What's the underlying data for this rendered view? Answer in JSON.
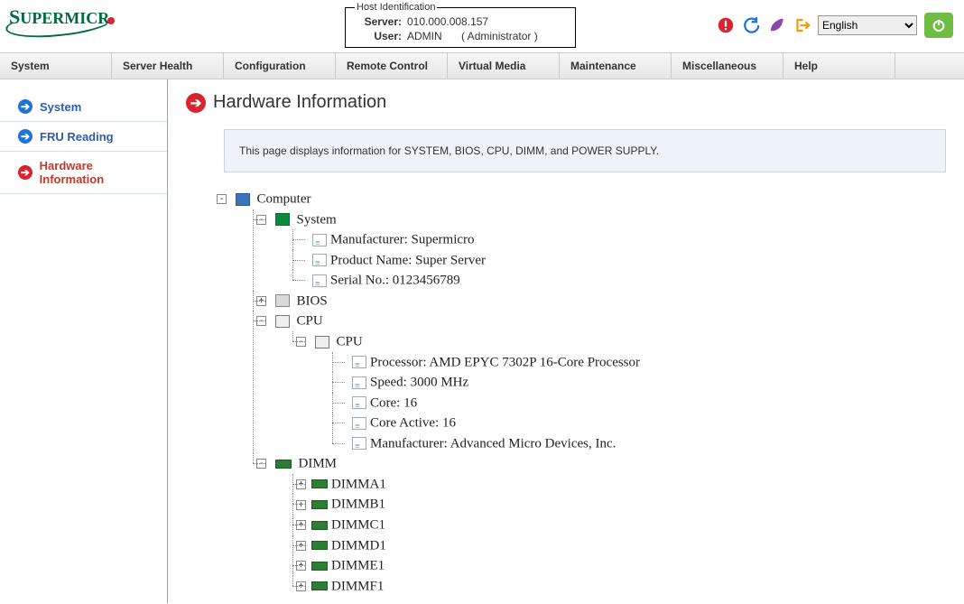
{
  "host_identification": {
    "legend": "Host Identification",
    "server_label": "Server:",
    "server_value": "010.000.008.157",
    "user_label": "User:",
    "user_value": "ADMIN",
    "role": "( Administrator )"
  },
  "header": {
    "language": "English",
    "languages": [
      "English"
    ]
  },
  "main_nav": [
    "System",
    "Server Health",
    "Configuration",
    "Remote Control",
    "Virtual Media",
    "Maintenance",
    "Miscellaneous",
    "Help"
  ],
  "sidebar": [
    {
      "label": "System",
      "active": false
    },
    {
      "label": "FRU Reading",
      "active": false
    },
    {
      "label": "Hardware Information",
      "active": true
    }
  ],
  "page": {
    "title": "Hardware Information",
    "description": "This page displays information for SYSTEM, BIOS, CPU, DIMM, and POWER SUPPLY."
  },
  "tree": {
    "computer": "Computer",
    "system": "System",
    "system_items": [
      "Manufacturer: Supermicro",
      "Product Name: Super Server",
      "Serial No.: 0123456789"
    ],
    "bios": "BIOS",
    "cpu": "CPU",
    "cpu_inner": "CPU",
    "cpu_items": [
      "Processor: AMD EPYC 7302P 16-Core Processor",
      "Speed: 3000 MHz",
      "Core: 16",
      "Core Active: 16",
      "Manufacturer: Advanced Micro Devices, Inc."
    ],
    "dimm": "DIMM",
    "dimm_items": [
      "DIMMA1",
      "DIMMB1",
      "DIMMC1",
      "DIMMD1",
      "DIMME1",
      "DIMMF1"
    ]
  }
}
